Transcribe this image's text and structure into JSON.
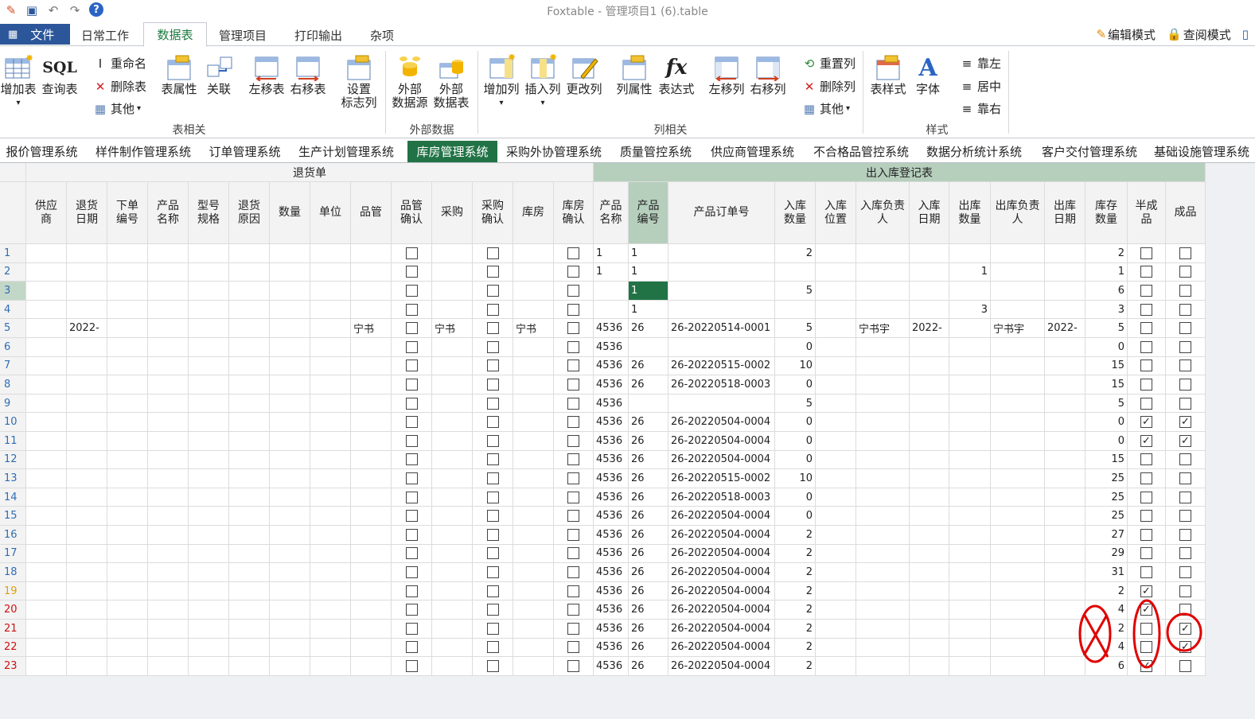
{
  "window": {
    "title": "Foxtable - 管理项目1 (6).table"
  },
  "quick_access": {
    "icons": [
      "app-logo-icon",
      "save-icon",
      "undo-icon",
      "redo-icon",
      "help-icon"
    ]
  },
  "menu": {
    "file": "文件",
    "tabs": [
      "日常工作",
      "数据表",
      "管理项目",
      "打印输出",
      "杂项"
    ],
    "active": "数据表",
    "edit_mode": "编辑模式",
    "query_mode": "查阅模式"
  },
  "ribbon": {
    "add_table": "增加表",
    "sql_query": "查询表",
    "sql_icon_text": "SQL",
    "rename": "重命名",
    "delete_table": "删除表",
    "other": "其他",
    "table_props": "表属性",
    "relation": "关联",
    "move_left_table": "左移表",
    "move_right_table": "右移表",
    "flag_col_1": "设置",
    "flag_col_2": "标志列",
    "ext_source_1": "外部",
    "ext_source_2": "数据源",
    "ext_table_1": "外部",
    "ext_table_2": "数据表",
    "add_col": "增加列",
    "insert_col": "插入列",
    "change_col": "更改列",
    "col_props": "列属性",
    "expression": "表达式",
    "fx_text": "fx",
    "move_left_col": "左移列",
    "move_right_col": "右移列",
    "reset_col": "重置列",
    "delete_col": "删除列",
    "other_col": "其他",
    "table_style": "表样式",
    "font": "字体",
    "align_left": "靠左",
    "align_center": "居中",
    "align_right": "靠右",
    "group_table": "表相关",
    "group_external": "外部数据",
    "group_column": "列相关",
    "group_style": "样式"
  },
  "systems": {
    "tabs": [
      "报价管理系统",
      "样件制作管理系统",
      "订单管理系统",
      "生产计划管理系统",
      "库房管理系统",
      "采购外协管理系统",
      "质量管控系统",
      "供应商管理系统",
      "不合格品管控系统",
      "数据分析统计系统",
      "客户交付管理系统",
      "基础设施管理系统"
    ],
    "active": "库房管理系统"
  },
  "grid": {
    "group_headers": [
      "退货单",
      "出入库登记表"
    ],
    "columns": [
      "供应商",
      "退货日期",
      "下单编号",
      "产品名称",
      "型号规格",
      "退货原因",
      "数量",
      "单位",
      "品管",
      "品管确认",
      "采购",
      "采购确认",
      "库房",
      "库房确认",
      "产品名称",
      "产品编号",
      "产品订单号",
      "入库数量",
      "入库位置",
      "入库负责人",
      "入库日期",
      "出库数量",
      "出库负责人",
      "出库日期",
      "库存数量",
      "半成品",
      "成品"
    ],
    "rows": [
      {
        "n": "1",
        "name": "1",
        "code": "1",
        "order": "",
        "in_qty": "2",
        "in_person": "",
        "in_date": "",
        "out_qty": "",
        "out_person": "",
        "out_date": "",
        "stock": "2",
        "semi": false,
        "fin": false
      },
      {
        "n": "2",
        "name": "1",
        "code": "1",
        "order": "",
        "in_qty": "",
        "in_person": "",
        "in_date": "",
        "out_qty": "1",
        "out_person": "",
        "out_date": "",
        "stock": "1",
        "semi": false,
        "fin": false
      },
      {
        "n": "3",
        "name": "",
        "code": "1",
        "order": "",
        "in_qty": "5",
        "in_person": "",
        "in_date": "",
        "out_qty": "",
        "out_person": "",
        "out_date": "",
        "stock": "6",
        "semi": false,
        "fin": false
      },
      {
        "n": "4",
        "name": "",
        "code": "1",
        "order": "",
        "in_qty": "",
        "in_person": "",
        "in_date": "",
        "out_qty": "3",
        "out_person": "",
        "out_date": "",
        "stock": "3",
        "semi": false,
        "fin": false
      },
      {
        "n": "5",
        "return_date": "2022-",
        "qc": "宁书",
        "purchase": "宁书",
        "warehouse": "宁书",
        "name": "4536",
        "code": "26",
        "order": "26-20220514-0001",
        "in_qty": "5",
        "in_person": "宁书宇",
        "in_date": "2022-",
        "out_qty": "",
        "out_person": "宁书宇",
        "out_date": "2022-",
        "stock": "5",
        "semi": false,
        "fin": false
      },
      {
        "n": "6",
        "name": "4536",
        "code": "",
        "order": "",
        "in_qty": "0",
        "stock": "0",
        "semi": false,
        "fin": false
      },
      {
        "n": "7",
        "name": "4536",
        "code": "26",
        "order": "26-20220515-0002",
        "in_qty": "10",
        "stock": "15",
        "semi": false,
        "fin": false
      },
      {
        "n": "8",
        "name": "4536",
        "code": "26",
        "order": "26-20220518-0003",
        "in_qty": "0",
        "stock": "15",
        "semi": false,
        "fin": false
      },
      {
        "n": "9",
        "name": "4536",
        "code": "",
        "order": "",
        "in_qty": "5",
        "stock": "5",
        "semi": false,
        "fin": false
      },
      {
        "n": "10",
        "name": "4536",
        "code": "26",
        "order": "26-20220504-0004",
        "in_qty": "0",
        "stock": "0",
        "semi": true,
        "fin": true
      },
      {
        "n": "11",
        "name": "4536",
        "code": "26",
        "order": "26-20220504-0004",
        "in_qty": "0",
        "stock": "0",
        "semi": true,
        "fin": true
      },
      {
        "n": "12",
        "name": "4536",
        "code": "26",
        "order": "26-20220504-0004",
        "in_qty": "0",
        "stock": "15",
        "semi": false,
        "fin": false
      },
      {
        "n": "13",
        "name": "4536",
        "code": "26",
        "order": "26-20220515-0002",
        "in_qty": "10",
        "stock": "25",
        "semi": false,
        "fin": false
      },
      {
        "n": "14",
        "name": "4536",
        "code": "26",
        "order": "26-20220518-0003",
        "in_qty": "0",
        "stock": "25",
        "semi": false,
        "fin": false
      },
      {
        "n": "15",
        "name": "4536",
        "code": "26",
        "order": "26-20220504-0004",
        "in_qty": "0",
        "stock": "25",
        "semi": false,
        "fin": false
      },
      {
        "n": "16",
        "name": "4536",
        "code": "26",
        "order": "26-20220504-0004",
        "in_qty": "2",
        "stock": "27",
        "semi": false,
        "fin": false
      },
      {
        "n": "17",
        "name": "4536",
        "code": "26",
        "order": "26-20220504-0004",
        "in_qty": "2",
        "stock": "29",
        "semi": false,
        "fin": false
      },
      {
        "n": "18",
        "name": "4536",
        "code": "26",
        "order": "26-20220504-0004",
        "in_qty": "2",
        "stock": "31",
        "semi": false,
        "fin": false
      },
      {
        "n": "19",
        "name": "4536",
        "code": "26",
        "order": "26-20220504-0004",
        "in_qty": "2",
        "stock": "2",
        "semi": true,
        "fin": false
      },
      {
        "n": "20",
        "name": "4536",
        "code": "26",
        "order": "26-20220504-0004",
        "in_qty": "2",
        "stock": "4",
        "semi": true,
        "fin": false
      },
      {
        "n": "21",
        "name": "4536",
        "code": "26",
        "order": "26-20220504-0004",
        "in_qty": "2",
        "stock": "2",
        "semi": false,
        "fin": true
      },
      {
        "n": "22",
        "name": "4536",
        "code": "26",
        "order": "26-20220504-0004",
        "in_qty": "2",
        "stock": "4",
        "semi": false,
        "fin": true
      },
      {
        "n": "23",
        "name": "4536",
        "code": "26",
        "order": "26-20220504-0004",
        "in_qty": "2",
        "stock": "6",
        "semi": true,
        "fin": false
      }
    ]
  },
  "colors": {
    "accent": "#217346",
    "header_highlight": "#b6cfbd",
    "annotation": "#e00000",
    "file_menu": "#2b579a"
  }
}
